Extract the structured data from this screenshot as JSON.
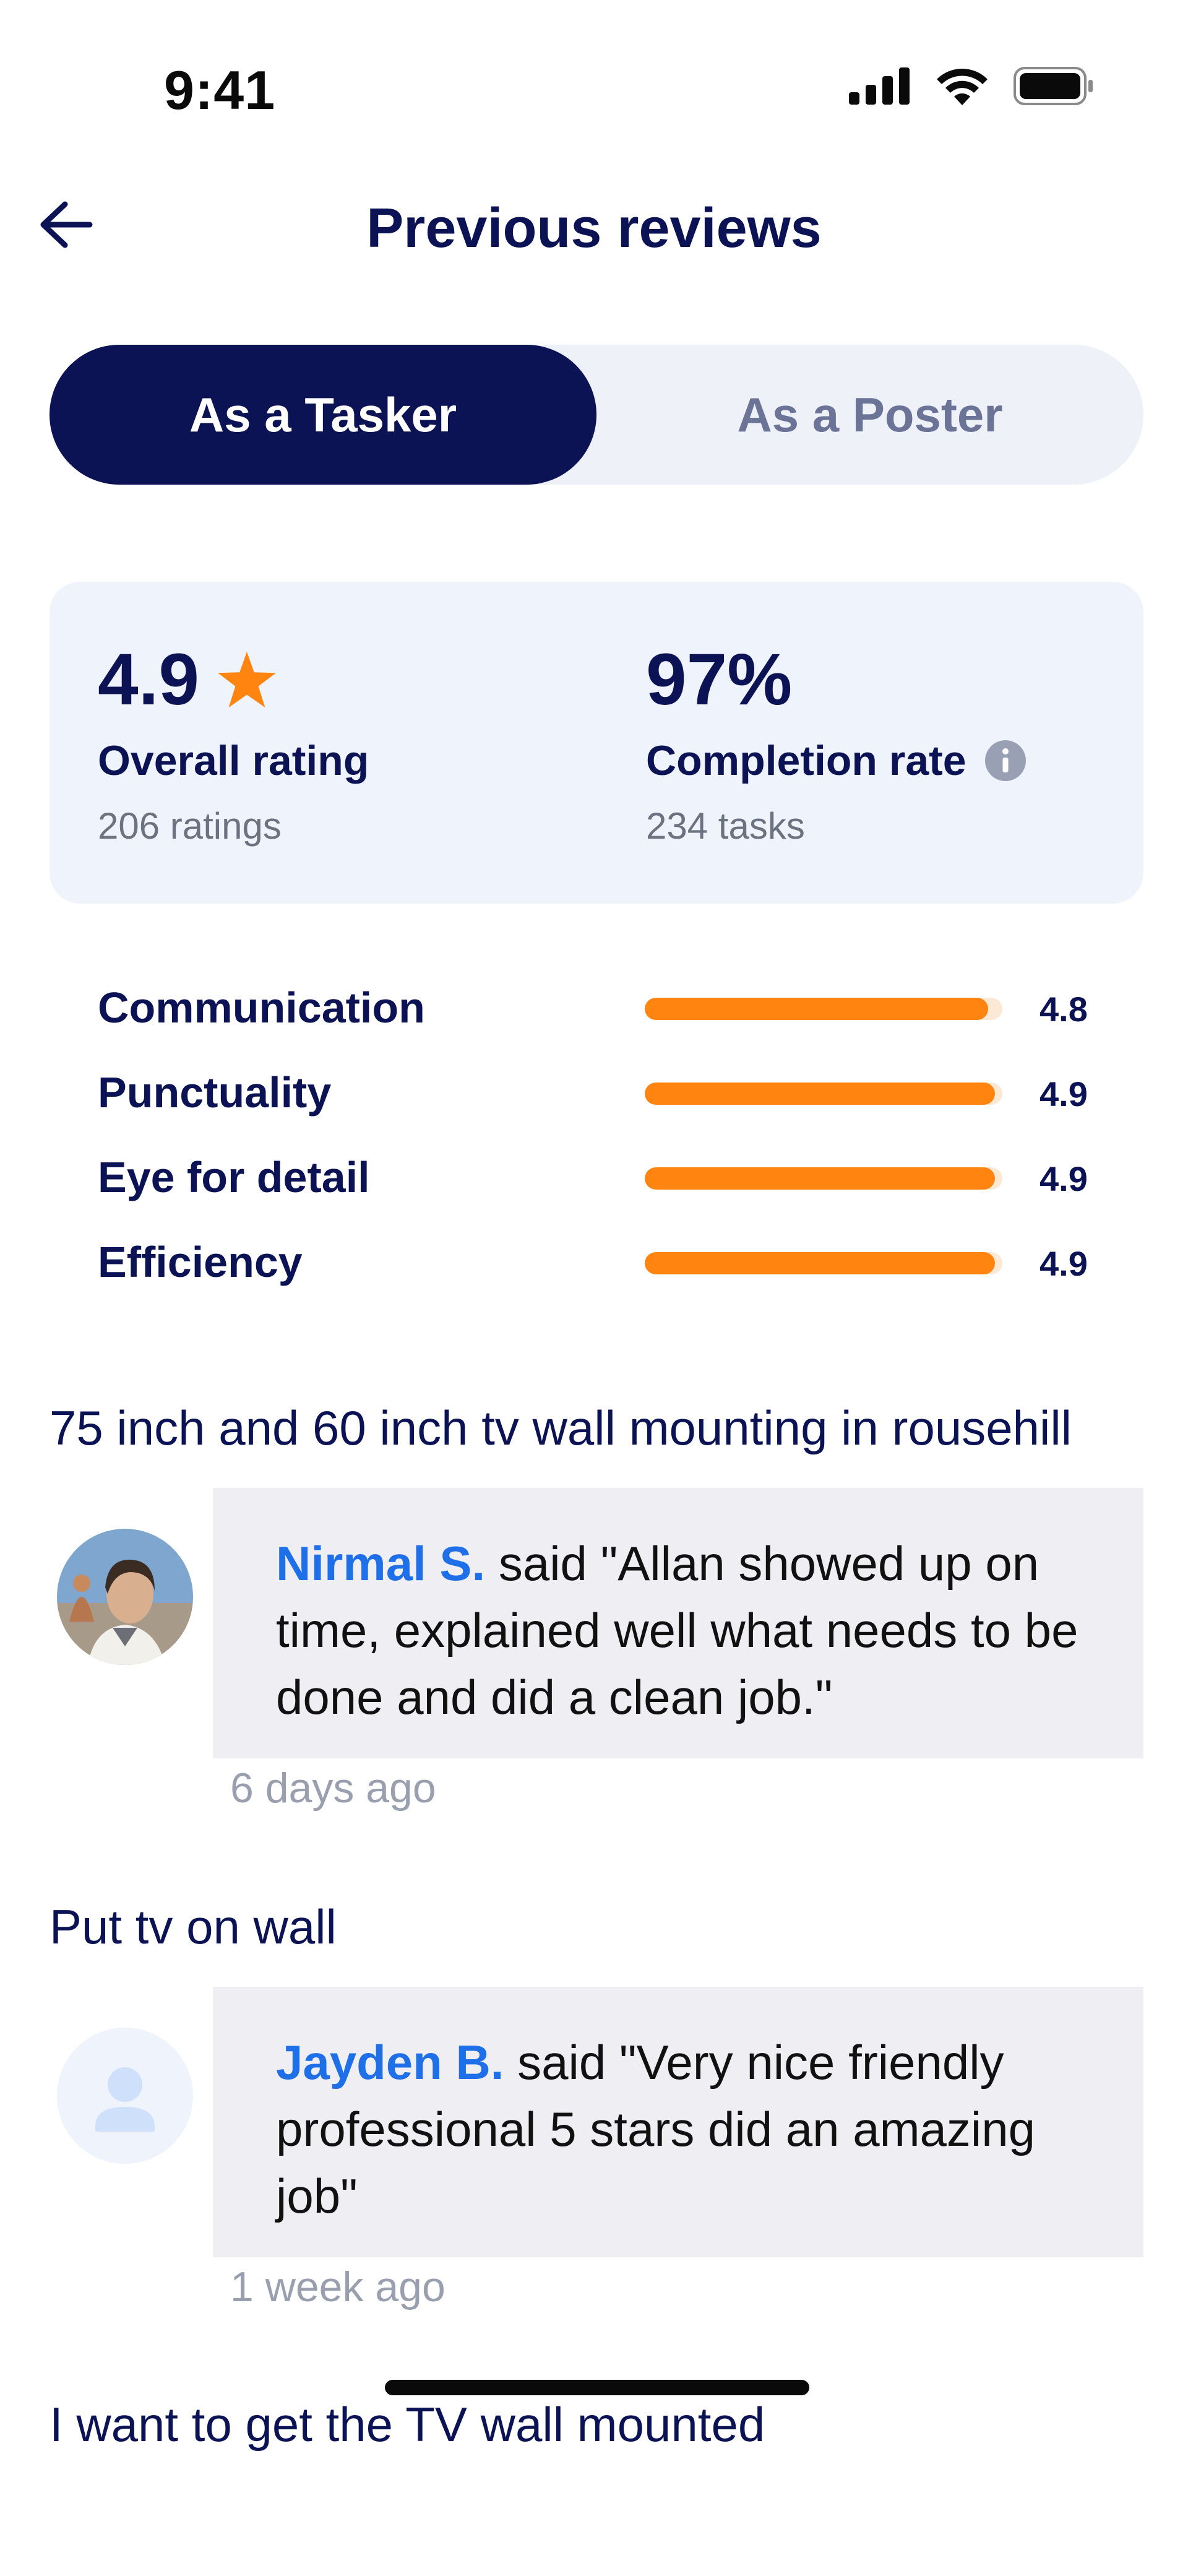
{
  "status_bar": {
    "time": "9:41"
  },
  "header": {
    "title": "Previous reviews"
  },
  "tabs": [
    {
      "label": "As a Tasker",
      "active": true
    },
    {
      "label": "As a Poster",
      "active": false
    }
  ],
  "summary": {
    "rating_value": "4.9",
    "rating_label": "Overall rating",
    "ratings_count": "206 ratings",
    "completion_value": "97%",
    "completion_label": "Completion rate",
    "tasks_count": "234 tasks"
  },
  "rating_breakdown": [
    {
      "label": "Communication",
      "value": "4.8",
      "fraction": 0.96
    },
    {
      "label": "Punctuality",
      "value": "4.9",
      "fraction": 0.98
    },
    {
      "label": "Eye for detail",
      "value": "4.9",
      "fraction": 0.98
    },
    {
      "label": "Efficiency",
      "value": "4.9",
      "fraction": 0.98
    }
  ],
  "reviews": [
    {
      "task_title": "75 inch and 60 inch tv wall mounting in rousehill",
      "reviewer": "Nirmal S.",
      "text": "said \"Allan showed up on time, explained well what needs to be done and did a clean job.\"",
      "time_ago": "6 days ago",
      "avatar": "photo"
    },
    {
      "task_title": "Put tv on wall",
      "reviewer": "Jayden  B.",
      "text": "said \"Very nice friendly professional 5 stars did an amazing job\"",
      "time_ago": "1 week ago",
      "avatar": "placeholder"
    }
  ],
  "next_task_title": "I want to get the TV wall mounted",
  "colors": {
    "navy": "#0b1354",
    "orange": "#ff8410",
    "link_blue": "#1f6fe8",
    "card_bg": "#eff3fc"
  },
  "icons": [
    "back-arrow-icon",
    "star-icon",
    "info-icon",
    "signal-icon",
    "wifi-icon",
    "battery-icon",
    "user-placeholder-icon"
  ]
}
